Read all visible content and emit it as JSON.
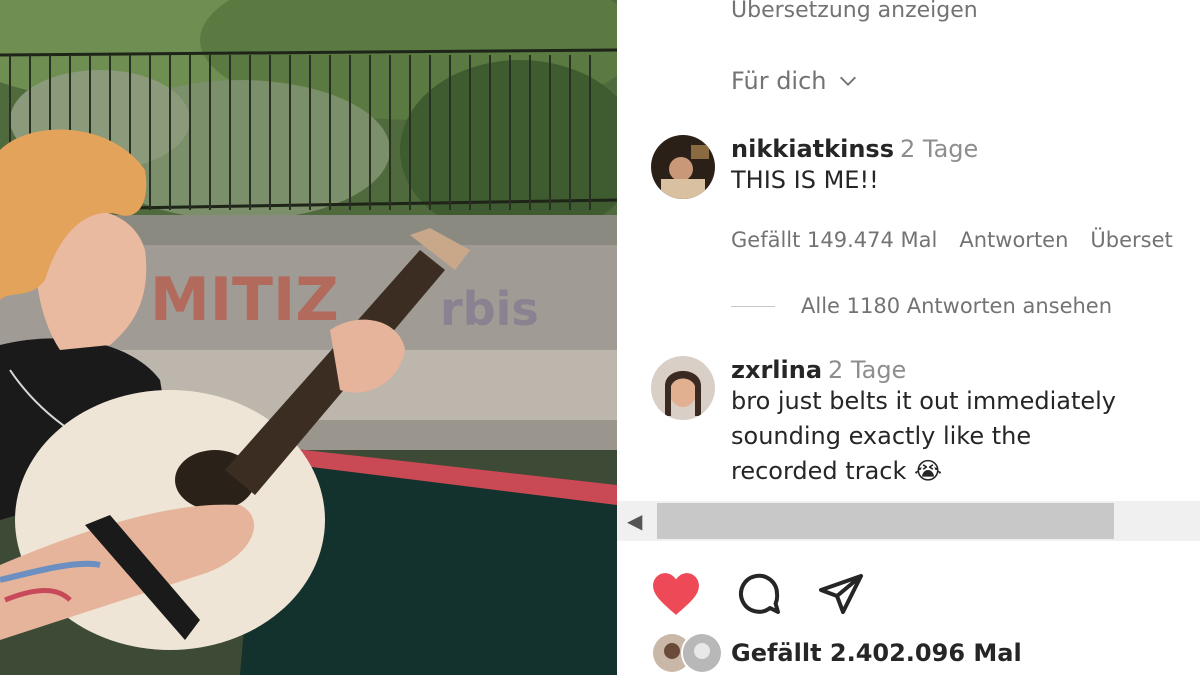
{
  "post": {
    "translate_label": "Übersetzung anzeigen",
    "sort_label": "Für dich"
  },
  "comments": [
    {
      "username": "nikkiatkinss",
      "time": "2 Tage",
      "text_lines": [
        "THIS IS ME!!"
      ],
      "likes": "Gefällt 149.474 Mal",
      "reply": "Antworten",
      "translate": "Überset"
    },
    {
      "username": "zxrlina",
      "time": "2 Tage",
      "text_lines": [
        "bro just belts it out immediately",
        "sounding exactly like the",
        "recorded track 😭"
      ]
    }
  ],
  "view_replies": "Alle 1180 Antworten ansehen",
  "likes_summary": "Gefällt 2.402.096 Mal",
  "colors": {
    "heart": "#ed4956",
    "text": "#262626",
    "muted": "#737373"
  },
  "icons": [
    "heart-filled-icon",
    "comment-icon",
    "share-icon",
    "chevron-down-icon",
    "heart-outline-icon",
    "scroll-left-arrow-icon"
  ]
}
